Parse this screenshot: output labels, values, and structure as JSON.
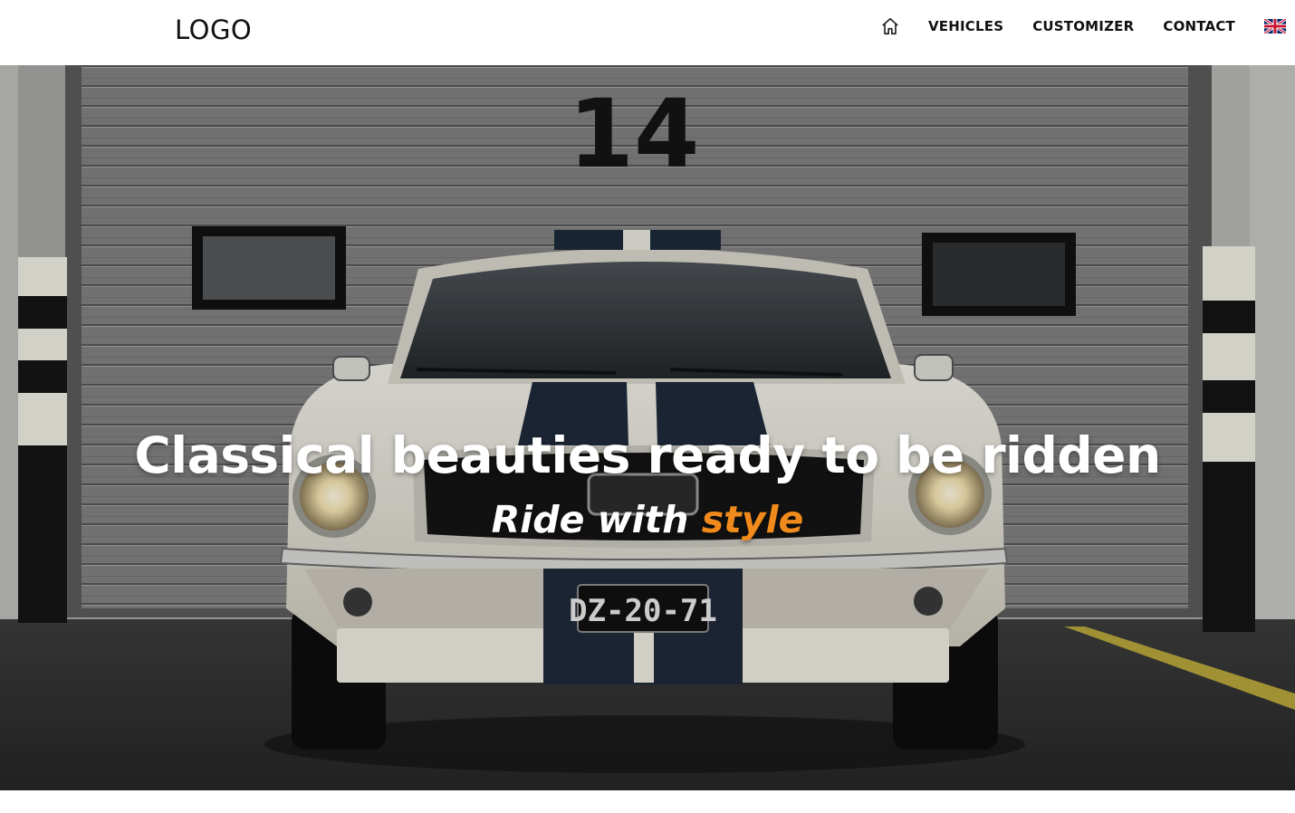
{
  "header": {
    "logo_text": "LOGO",
    "nav": {
      "home_icon": "home-icon",
      "items": [
        {
          "label": "VEHICLES"
        },
        {
          "label": "CUSTOMIZER"
        },
        {
          "label": "CONTACT"
        }
      ],
      "language_flag": "uk-flag-icon"
    }
  },
  "hero": {
    "headline": "Classical beauties ready to be ridden",
    "subheadline_lead": "Ride with ",
    "subheadline_accent": "style",
    "garage_number": "14",
    "license_plate": "DZ-20-71"
  },
  "colors": {
    "accent": "#f08a1c",
    "header_bg": "#ffffff",
    "text_dark": "#111111"
  }
}
